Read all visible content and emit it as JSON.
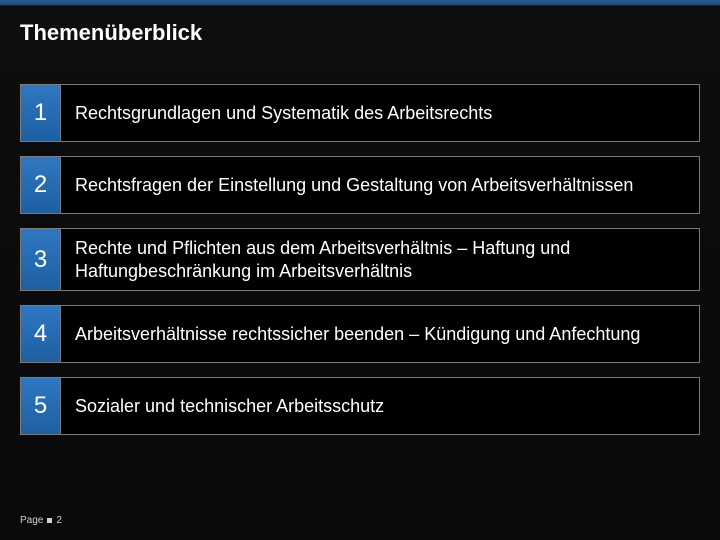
{
  "title": "Themenüberblick",
  "items": [
    {
      "num": "1",
      "text": "Rechtsgrundlagen und Systematik des Arbeitsrechts"
    },
    {
      "num": "2",
      "text": "Rechtsfragen der Einstellung und Gestaltung von Arbeitsverhältnissen"
    },
    {
      "num": "3",
      "text": "Rechte und Pflichten aus dem Arbeitsverhältnis – Haftung und Haftungbeschränkung im Arbeitsverhältnis"
    },
    {
      "num": "4",
      "text": "Arbeitsverhältnisse rechtssicher beenden – Kündigung und Anfechtung"
    },
    {
      "num": "5",
      "text": "Sozialer und technischer Arbeitsschutz"
    }
  ],
  "footer": {
    "page_label": "Page",
    "page_number": "2"
  }
}
